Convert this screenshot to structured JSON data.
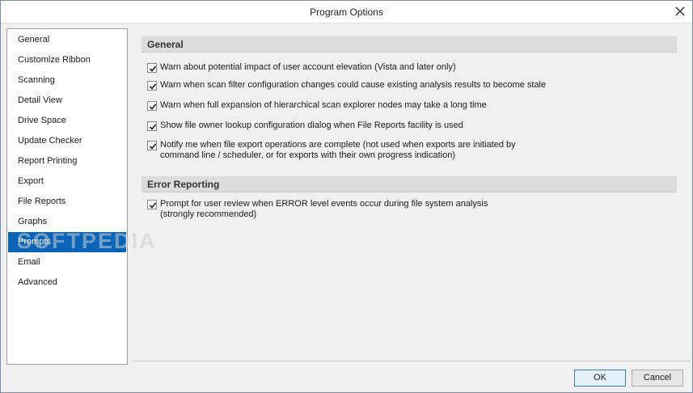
{
  "window": {
    "title": "Program Options"
  },
  "nav": {
    "items": [
      {
        "label": "General"
      },
      {
        "label": "Customize Ribbon"
      },
      {
        "label": "Scanning"
      },
      {
        "label": "Detail View"
      },
      {
        "label": "Drive Space"
      },
      {
        "label": "Update Checker"
      },
      {
        "label": "Report Printing"
      },
      {
        "label": "Export"
      },
      {
        "label": "File Reports"
      },
      {
        "label": "Graphs"
      },
      {
        "label": "Prompts",
        "selected": true
      },
      {
        "label": "Email"
      },
      {
        "label": "Advanced"
      }
    ]
  },
  "watermark": "SOFTPEDIA",
  "sections": {
    "general": {
      "title": "General",
      "options": [
        {
          "label": "Warn about potential impact of user account elevation (Vista and later only)",
          "checked": true
        },
        {
          "label": "Warn when scan filter configuration changes could cause existing analysis results to become stale",
          "checked": true
        },
        {
          "label": "Warn when full expansion of hierarchical scan explorer nodes may take a long time",
          "checked": true
        },
        {
          "label": "Show file owner lookup configuration dialog when File Reports facility is used",
          "checked": true
        },
        {
          "label": "Notify me when file export operations are complete (not used when exports are initiated by command line / scheduler, or for exports with their own progress indication)",
          "checked": true
        }
      ]
    },
    "error_reporting": {
      "title": "Error Reporting",
      "options": [
        {
          "label": "Prompt for user review when ERROR level events occur during file system analysis (strongly recommended)",
          "checked": true
        }
      ]
    }
  },
  "buttons": {
    "ok": "OK",
    "cancel": "Cancel"
  }
}
